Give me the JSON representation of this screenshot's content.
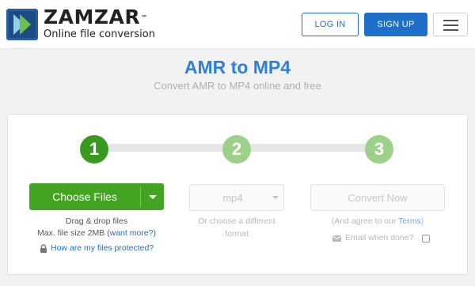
{
  "header": {
    "brand": "ZAMZAR",
    "trademark": "™",
    "tagline": "Online file conversion",
    "login_label": "LOG IN",
    "signup_label": "SIGN UP",
    "menu_icon": "hamburger-icon",
    "logo_icon": "zamzar-logo-icon"
  },
  "page": {
    "title": "AMR to MP4",
    "subtitle": "Convert AMR to MP4 online and free"
  },
  "steps": [
    "1",
    "2",
    "3"
  ],
  "upload": {
    "choose_label": "Choose Files",
    "drag_text": "Drag & drop files",
    "max_size_prefix": "Max. file size 2MB (",
    "want_more": "want more?",
    "max_size_suffix": ")",
    "protected_link": "How are my files protected?",
    "lock_icon": "lock-icon"
  },
  "format": {
    "selected": "mp4",
    "hint_line1": "Or choose a different",
    "hint_line2": "format"
  },
  "convert": {
    "label": "Convert Now",
    "agree_prefix": "(And agree to our ",
    "terms_link": "Terms",
    "agree_suffix": ")",
    "email_label": "Email when done?",
    "email_icon": "envelope-icon",
    "email_checked": false
  },
  "colors": {
    "brand_blue": "#1e6fc7",
    "title_blue": "#2f7fd8",
    "step_active": "#3a9a20",
    "step_inactive": "#9dd18a",
    "choose_green": "#43a422"
  }
}
